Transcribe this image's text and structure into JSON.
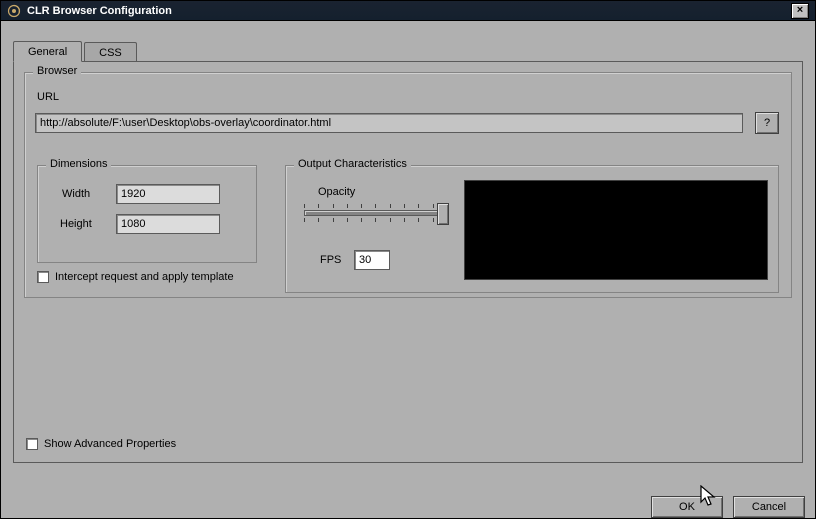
{
  "window": {
    "title": "CLR Browser Configuration"
  },
  "tabs": {
    "general": "General",
    "css": "CSS"
  },
  "browser_group": {
    "legend": "Browser",
    "url_label": "URL",
    "url_value": "http://absolute/F:\\user\\Desktop\\obs-overlay\\coordinator.html",
    "help_btn": "?",
    "intercept_label": "Intercept request and apply template"
  },
  "dimensions_group": {
    "legend": "Dimensions",
    "width_label": "Width",
    "width_value": "1920",
    "height_label": "Height",
    "height_value": "1080"
  },
  "output_group": {
    "legend": "Output Characteristics",
    "opacity_label": "Opacity",
    "opacity_value": 100,
    "fps_label": "FPS",
    "fps_value": "30"
  },
  "show_advanced_label": "Show Advanced Properties",
  "buttons": {
    "ok": "OK",
    "cancel": "Cancel"
  }
}
